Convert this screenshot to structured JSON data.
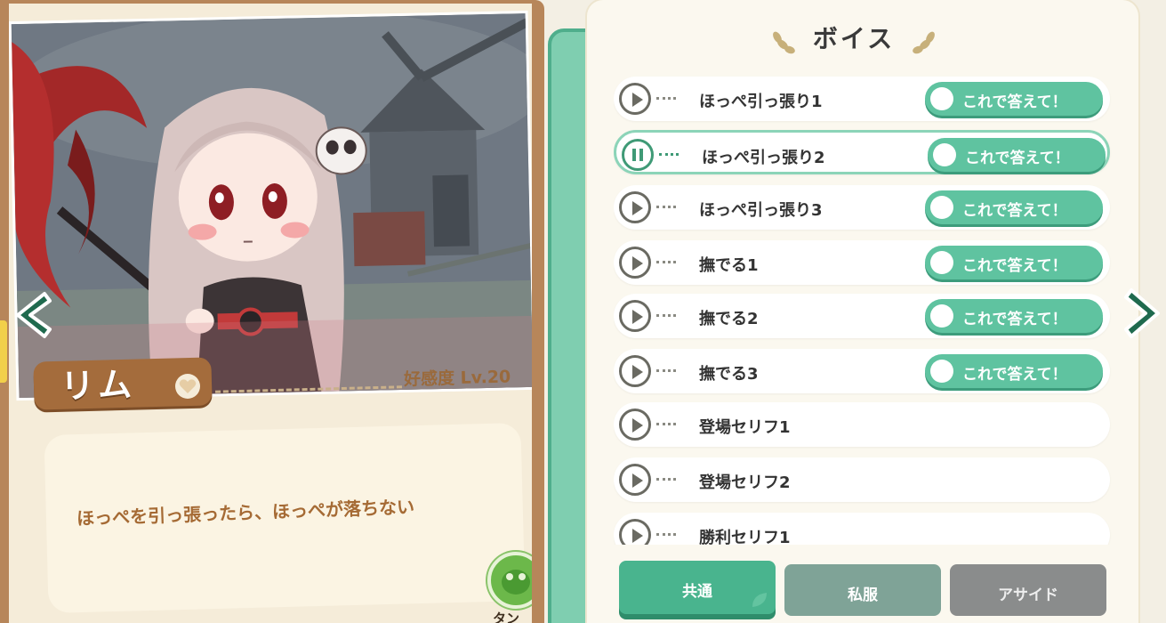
{
  "character": {
    "name": "リム",
    "affinity_text": "好感度 Lv.20",
    "comment": "ほっぺを引っ張ったら、ほっぺが落ちない",
    "badge_label": "タンス"
  },
  "panel": {
    "title": "ボイス",
    "answer_label": "これで答えて！",
    "voices": [
      {
        "label": "ほっぺ引っ張り1",
        "playing": false,
        "has_answer": true
      },
      {
        "label": "ほっぺ引っ張り2",
        "playing": true,
        "has_answer": true
      },
      {
        "label": "ほっぺ引っ張り3",
        "playing": false,
        "has_answer": true
      },
      {
        "label": "撫でる1",
        "playing": false,
        "has_answer": true
      },
      {
        "label": "撫でる2",
        "playing": false,
        "has_answer": true
      },
      {
        "label": "撫でる3",
        "playing": false,
        "has_answer": true
      },
      {
        "label": "登場セリフ1",
        "playing": false,
        "has_answer": false
      },
      {
        "label": "登場セリフ2",
        "playing": false,
        "has_answer": false
      },
      {
        "label": "勝利セリフ1",
        "playing": false,
        "has_answer": false
      }
    ]
  },
  "tabs": [
    {
      "label": "共通",
      "selected": true
    },
    {
      "label": "私服",
      "selected": false
    },
    {
      "label": "アサイド",
      "selected": false
    }
  ],
  "colors": {
    "accent_green": "#5fc3a0",
    "card_brown": "#b7865a",
    "name_plate": "#a46c3c"
  }
}
